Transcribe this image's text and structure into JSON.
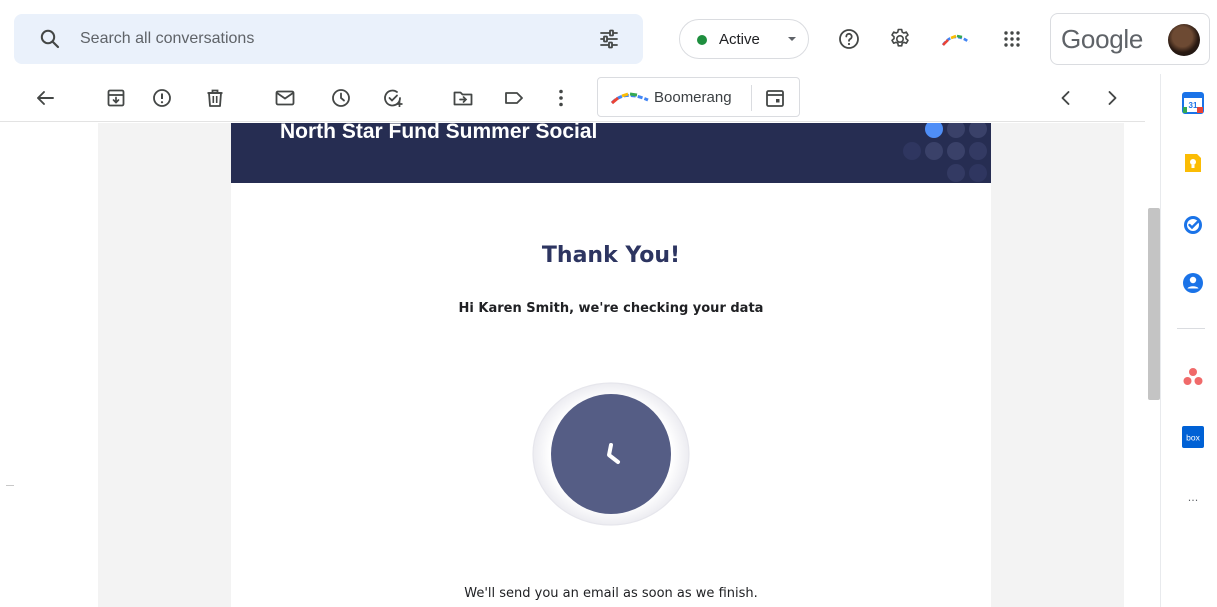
{
  "search": {
    "placeholder": "Search all conversations"
  },
  "status": {
    "label": "Active",
    "color": "#1e8e3e"
  },
  "account": {
    "brand": "Google"
  },
  "toolbar": {
    "boomerang_label": "Boomerang",
    "icons": [
      "back-arrow-icon",
      "archive-icon",
      "report-spam-icon",
      "delete-icon",
      "mark-unread-icon",
      "snooze-icon",
      "add-to-tasks-icon",
      "move-to-icon",
      "label-icon",
      "more-vert-icon",
      "boomerang-calendar-icon",
      "newer-chevron-icon",
      "older-chevron-icon"
    ]
  },
  "side_panel": {
    "apps": [
      "google-calendar-icon",
      "google-keep-icon",
      "google-tasks-icon",
      "google-contacts-icon",
      "asana-icon",
      "box-icon",
      "more-apps-icon"
    ],
    "calendar_day": "31",
    "box_label": "box",
    "more_label": "···"
  },
  "email": {
    "banner_title": "North Star Fund Summer Social",
    "heading": "Thank You!",
    "subheading": "Hi Karen Smith, we're checking your data",
    "footer": "We'll send you an email as soon as we finish."
  },
  "colors": {
    "banner": "#262d52",
    "heading": "#2d3561",
    "clock": "#555d85",
    "search_bg": "#eaf1fb"
  }
}
